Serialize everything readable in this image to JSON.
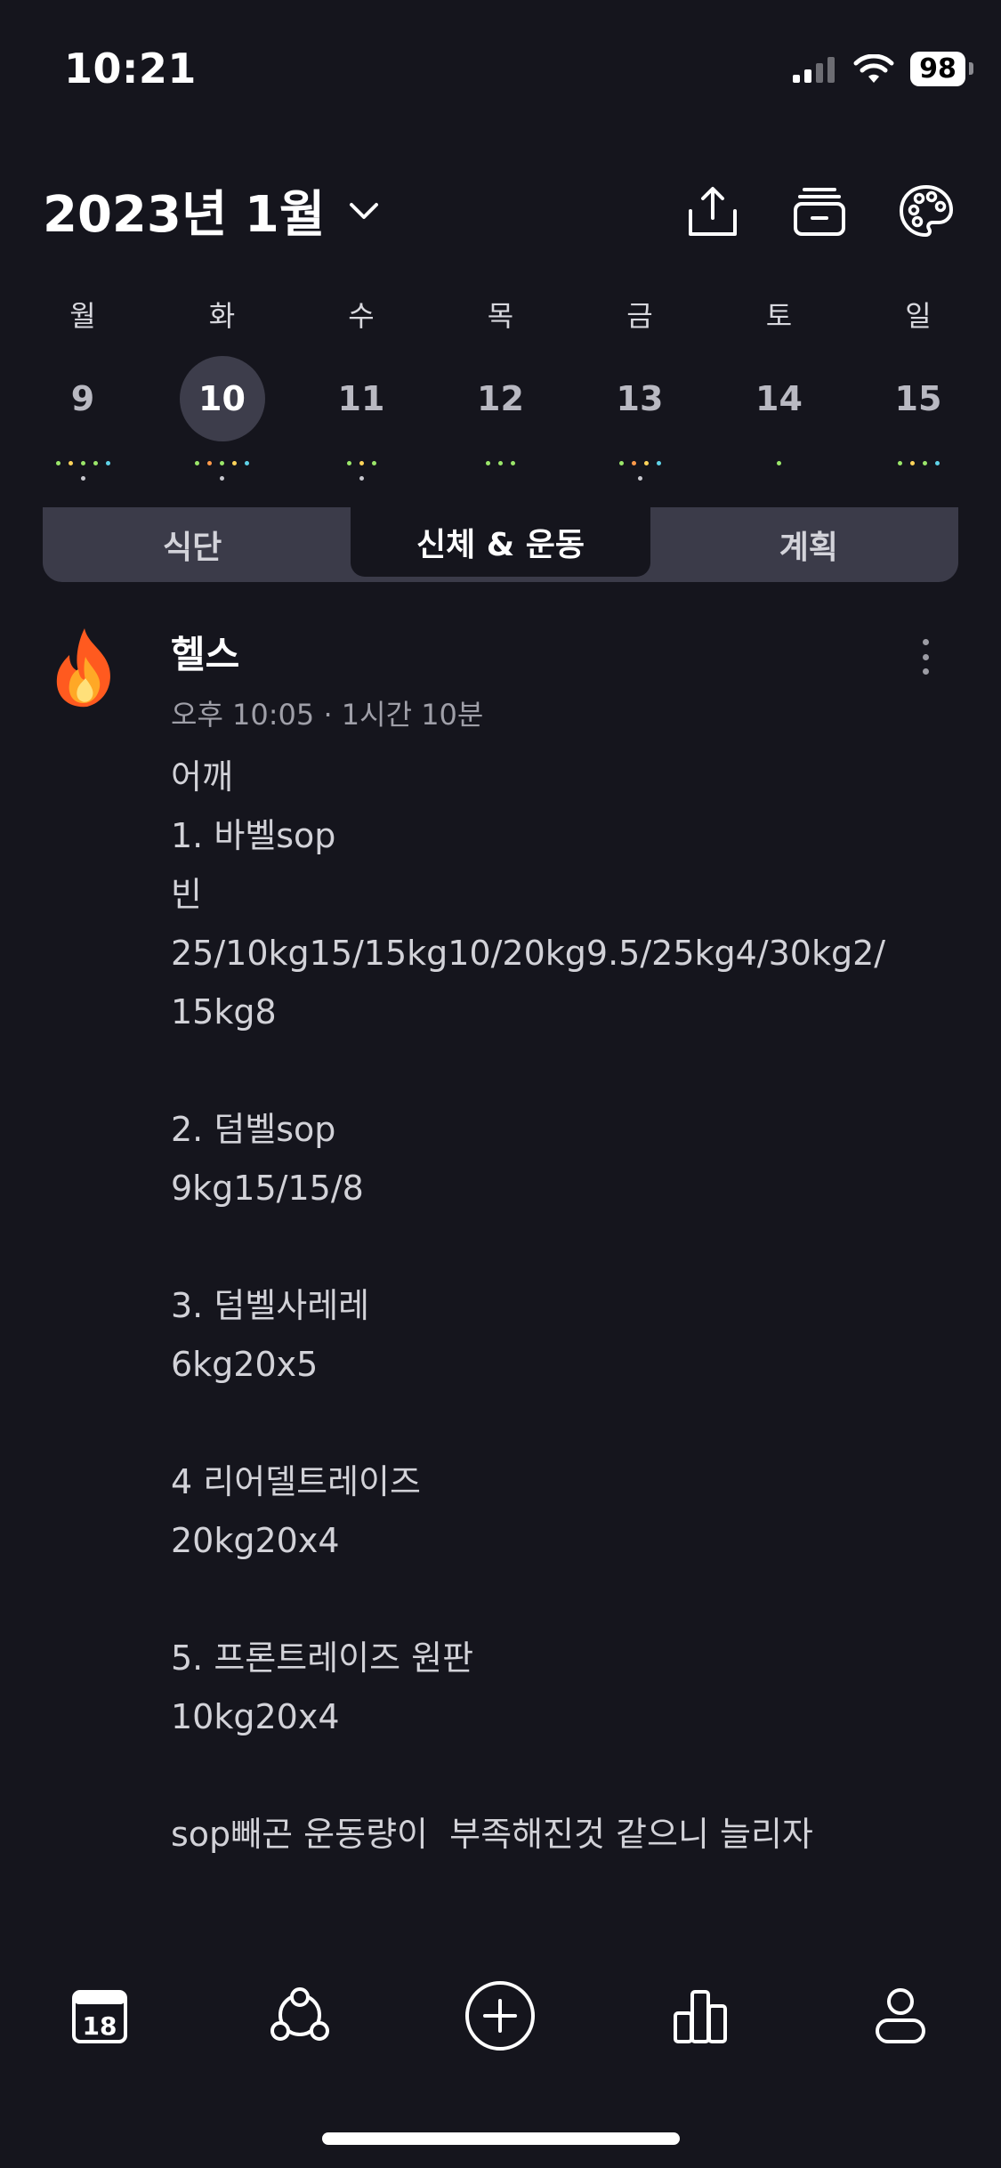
{
  "status": {
    "time": "10:21",
    "battery": "98"
  },
  "header": {
    "month_title": "2023년 1월"
  },
  "week": [
    {
      "name": "월",
      "num": "9",
      "selected": false,
      "dots": [
        "#9be76a",
        "#ffd45a",
        "#9be76a",
        "#9be76a",
        "#5fd3e8"
      ],
      "subdot": true
    },
    {
      "name": "화",
      "num": "10",
      "selected": true,
      "dots": [
        "#9be76a",
        "#ff9a4a",
        "#9be76a",
        "#ffd45a",
        "#5fd3e8"
      ],
      "subdot": true
    },
    {
      "name": "수",
      "num": "11",
      "selected": false,
      "dots": [
        "#9be76a",
        "#ffd45a",
        "#9be76a"
      ],
      "subdot": true
    },
    {
      "name": "목",
      "num": "12",
      "selected": false,
      "dots": [
        "#9be76a",
        "#9be76a",
        "#9be76a"
      ],
      "subdot": false
    },
    {
      "name": "금",
      "num": "13",
      "selected": false,
      "dots": [
        "#9be76a",
        "#ff9a4a",
        "#ffd45a",
        "#5fd3e8"
      ],
      "subdot": true
    },
    {
      "name": "토",
      "num": "14",
      "selected": false,
      "dots": [
        "#9be76a"
      ],
      "subdot": false
    },
    {
      "name": "일",
      "num": "15",
      "selected": false,
      "dots": [
        "#9be76a",
        "#ffd45a",
        "#9be76a",
        "#5fd3e8"
      ],
      "subdot": false
    }
  ],
  "tabs": [
    {
      "label": "식단",
      "active": false
    },
    {
      "label": "신체 & 운동",
      "active": true
    },
    {
      "label": "계획",
      "active": false
    }
  ],
  "post": {
    "icon": "fire-icon",
    "title": "헬스",
    "meta": "오후 10:05 · 1시간 10분",
    "body": "어깨\n1. 바벨sop\n빈\n25/10kg15/15kg10/20kg9.5/25kg4/30kg2/\n15kg8\n\n2. 덤벨sop\n9kg15/15/8\n\n3. 덤벨사레레\n6kg20x5\n\n4 리어델트레이즈\n20kg20x4\n\n5. 프론트레이즈 원판\n10kg20x4\n\nsop빼곤 운동량이  부족해진것 같으니 늘리자"
  },
  "tabbar": {
    "calendar_day": "18"
  },
  "colors": {
    "background": "#15151d",
    "tab_bg": "#3b3b49",
    "selected_day": "#3d3d4b"
  }
}
